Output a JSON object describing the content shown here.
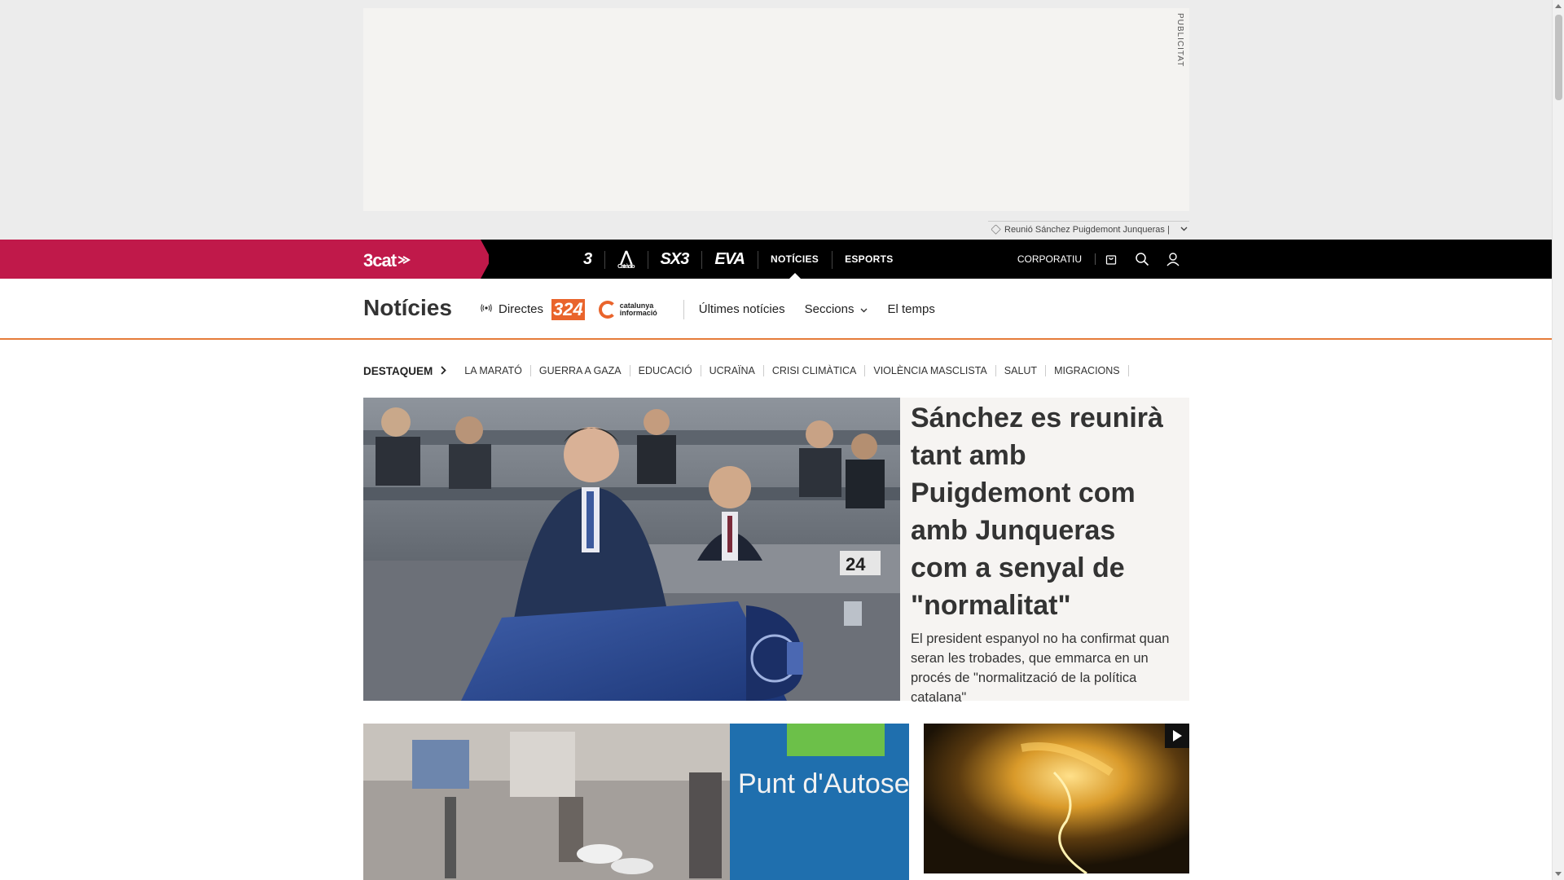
{
  "ad": {
    "label": "PUBLICITAT"
  },
  "tagline": {
    "text": "Reunió Sánchez Puigdemont Junqueras |"
  },
  "topnav": {
    "brand": "3cat",
    "channels": [
      {
        "label": "3",
        "kind": "logo"
      },
      {
        "label": "Catràdio",
        "kind": "logo"
      },
      {
        "label": "SX3",
        "kind": "logo"
      },
      {
        "label": "EVA",
        "kind": "logo"
      },
      {
        "label": "NOTÍCIES",
        "kind": "text",
        "active": true
      },
      {
        "label": "ESPORTS",
        "kind": "text"
      }
    ],
    "corporate": "CORPORATIU",
    "icons": [
      "cart-icon",
      "search-icon",
      "user-icon"
    ]
  },
  "section": {
    "title": "Notícies",
    "directes": "Directes",
    "channel_324": "324",
    "catinfo": "catalunya informació",
    "links": [
      "Últimes notícies",
      "Seccions",
      "El temps"
    ]
  },
  "destaquem": {
    "label": "DESTAQUEM",
    "topics": [
      "LA MARATÓ",
      "GUERRA A GAZA",
      "EDUCACIÓ",
      "UCRAÏNA",
      "CRISI CLIMÀTICA",
      "VIOLÈNCIA MASCLISTA",
      "SALUT",
      "MIGRACIONS"
    ]
  },
  "hero": {
    "title": "Sánchez es reunirà tant amb Puigdemont com amb Junqueras com a senyal de \"normalitat\"",
    "subtitle": "El president espanyol no ha confirmat quan seran les trobades, que emmarca en un procés de \"normalització de la política catalana\"",
    "image_sign": "24"
  },
  "card1": {
    "sign": "Punt d'Autoservei"
  },
  "colors": {
    "brand": "#c0194a",
    "accent": "#e57c3a",
    "nav_bg": "#000000"
  }
}
